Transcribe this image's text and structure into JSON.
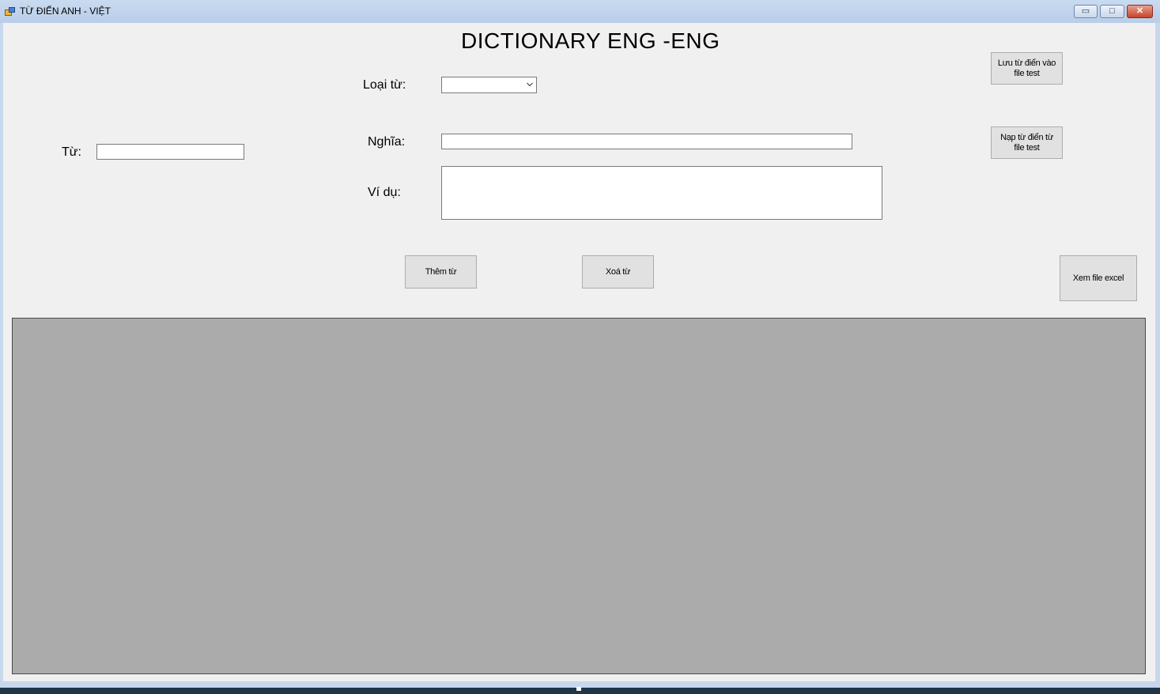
{
  "window": {
    "title": "TỪ ĐIỂN ANH - VIỆT",
    "minimize_glyph": "▭",
    "maximize_glyph": "□",
    "close_glyph": "✕"
  },
  "form": {
    "heading": "DICTIONARY ENG -ENG",
    "word_label": "Từ:",
    "word_value": "",
    "type_label": "Loại từ:",
    "type_value": "",
    "meaning_label": "Nghĩa:",
    "meaning_value": "",
    "example_label": "Ví dụ:",
    "example_value": ""
  },
  "buttons": {
    "save_to_file": "Lưu từ điển vào\nfile test",
    "load_from_file": "Nạp từ điển từ\nfile test",
    "add_word": "Thêm từ",
    "delete_word": "Xoá từ",
    "view_excel": "Xem file excel"
  },
  "colors": {
    "client_bg": "#f0f0f0",
    "grid_bg": "#ababab",
    "button_bg": "#e1e1e1"
  },
  "icons": {
    "app": "app-icon",
    "dropdown": "chevron-down-icon"
  }
}
